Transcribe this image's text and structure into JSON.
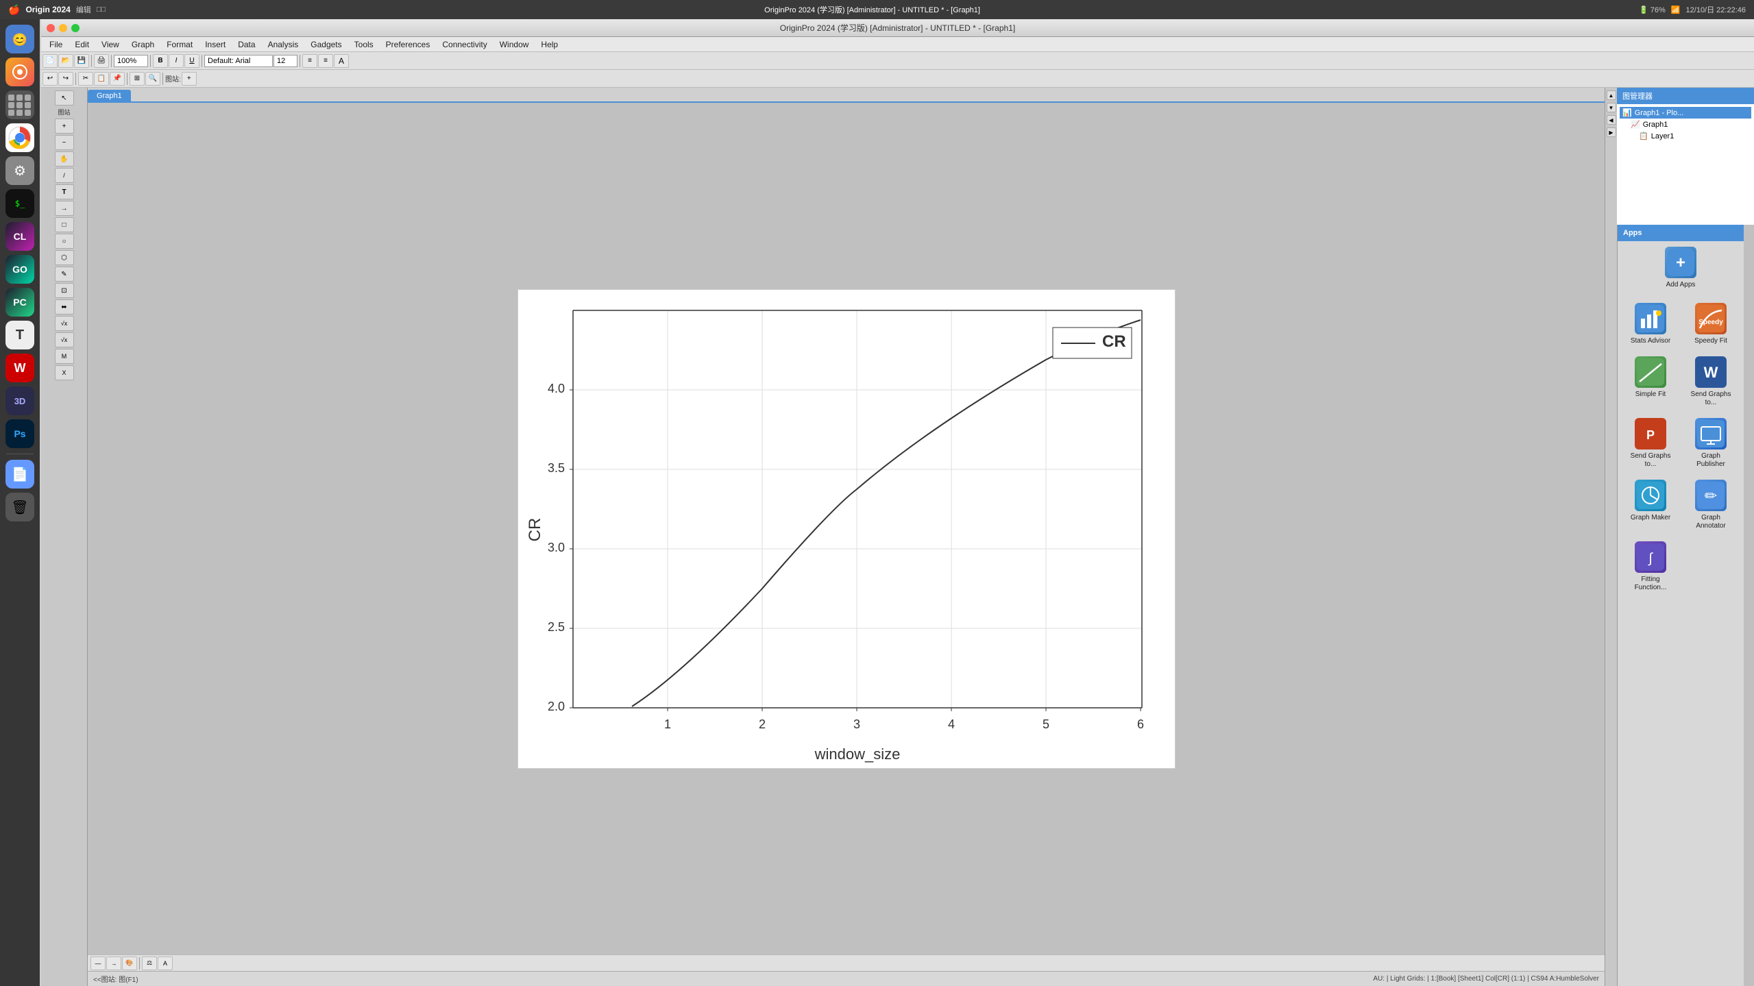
{
  "window": {
    "title": "OriginPro 2024 (学习版) [Administrator] - UNTITLED * - [Graph1]",
    "datetime": "12/10/日 22:22:46"
  },
  "mac_topbar": {
    "app_name": "Origin 2024",
    "right_text": "12/10/日 22:22:46"
  },
  "menu": {
    "items": [
      "File",
      "Edit",
      "View",
      "Graph",
      "Format",
      "Insert",
      "Data",
      "Analysis",
      "Gadgets",
      "Tools",
      "Preferences",
      "Connectivity",
      "Window",
      "Help"
    ]
  },
  "graph_tab": {
    "label": "Graph1"
  },
  "chart": {
    "x_axis_label": "window_size",
    "y_axis_label": "CR",
    "legend_label": "CR",
    "x_ticks": [
      "1",
      "2",
      "3",
      "4",
      "5",
      "6"
    ],
    "y_ticks": [
      "2.0",
      "2.5",
      "3.0",
      "3.5",
      "4.0"
    ],
    "curve_points": [
      [
        0,
        185
      ],
      [
        30,
        168
      ],
      [
        80,
        140
      ],
      [
        160,
        100
      ],
      [
        240,
        62
      ],
      [
        320,
        28
      ],
      [
        390,
        6
      ]
    ],
    "x_min": 0,
    "x_max": 700,
    "y_min": 0,
    "y_max": 220
  },
  "right_panel": {
    "title": "图管理器",
    "tree_items": [
      {
        "label": "Graph1 - Plo...",
        "level": 0,
        "selected": true
      },
      {
        "label": "Graph1",
        "level": 1,
        "selected": false
      },
      {
        "label": "Layer1",
        "level": 2,
        "selected": false
      }
    ]
  },
  "apps_panel": {
    "title": "Apps",
    "add_button_label": "Add Apps",
    "apps": [
      {
        "label": "Stats Advisor",
        "icon_color": "#4a90d9",
        "icon_char": "📊"
      },
      {
        "label": "Speedy Fit",
        "icon_color": "#e07030",
        "icon_char": "📈"
      },
      {
        "label": "Simple Fit",
        "icon_color": "#5ba55b",
        "icon_char": "📉"
      },
      {
        "label": "Send Graphs to...",
        "icon_color": "#4a70c0",
        "icon_char": "📄"
      },
      {
        "label": "Send Graphs to...",
        "icon_color": "#c03030",
        "icon_char": "📑"
      },
      {
        "label": "Graph Publisher",
        "icon_color": "#4a90d9",
        "icon_char": "🖼"
      },
      {
        "label": "Graph Maker",
        "icon_color": "#30a0d0",
        "icon_char": "📊"
      },
      {
        "label": "Graph Annotator",
        "icon_color": "#5090e0",
        "icon_char": "✏️"
      },
      {
        "label": "Fitting Function...",
        "icon_color": "#6050c0",
        "icon_char": "∫"
      }
    ]
  },
  "status_bar": {
    "left": "<<图站: 图(F1)",
    "center": "",
    "right": "AU: | Light Grids: | 1:[Book] [Sheet1] Col[CR] (1:1) | CS94 A:HumbleSolver"
  },
  "dock": {
    "icons": [
      {
        "name": "finder",
        "char": "🔵",
        "bg": "#4a90d9"
      },
      {
        "name": "launchpad",
        "char": "🚀",
        "bg": "#f5a623"
      },
      {
        "name": "apps",
        "char": "🔲",
        "bg": "#555"
      },
      {
        "name": "chrome",
        "char": "🌐",
        "bg": "#fff"
      },
      {
        "name": "system-prefs",
        "char": "⚙️",
        "bg": "#888"
      },
      {
        "name": "terminal",
        "char": "$_",
        "bg": "#111"
      },
      {
        "name": "clion",
        "char": "C",
        "bg": "#1e1e2e"
      },
      {
        "name": "goland",
        "char": "G",
        "bg": "#1e1e2e"
      },
      {
        "name": "pycharm",
        "char": "P",
        "bg": "#1e1e2e"
      },
      {
        "name": "typora",
        "char": "T",
        "bg": "#eee"
      },
      {
        "name": "wps",
        "char": "W",
        "bg": "#c00"
      },
      {
        "name": "3d",
        "char": "3D",
        "bg": "#333"
      },
      {
        "name": "photoshop",
        "char": "Ps",
        "bg": "#001e36"
      },
      {
        "name": "documents",
        "char": "📄",
        "bg": "#6699ff"
      },
      {
        "name": "trash",
        "char": "🗑",
        "bg": "#555"
      }
    ]
  }
}
